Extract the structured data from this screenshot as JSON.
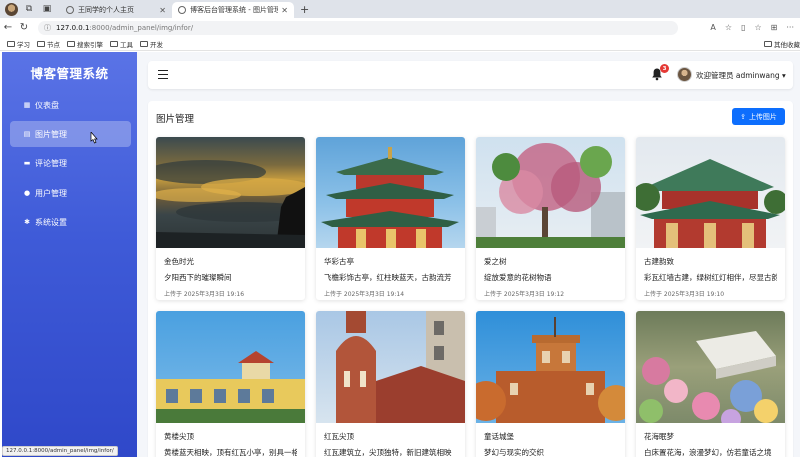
{
  "browser": {
    "tabs": [
      {
        "label": "王同学的个人主页",
        "active": false
      },
      {
        "label": "博客后台管理系统 - 图片管理",
        "active": true
      }
    ],
    "url": {
      "host": "127.0.0.1",
      "path": ":8000/admin_panel/img/infor/"
    },
    "bookmarks": [
      "学习",
      "节点",
      "搜索引擎",
      "工具",
      "开发"
    ],
    "bookmarks_right": "其他收藏",
    "status_url": "127.0.0.1:8000/admin_panel/img/infor/"
  },
  "sidebar": {
    "brand": "博客管理系统",
    "items": [
      {
        "label": "仪表盘",
        "icon": "grid-icon",
        "active": false
      },
      {
        "label": "图片管理",
        "icon": "file-icon",
        "active": true
      },
      {
        "label": "评论管理",
        "icon": "comment-icon",
        "active": false
      },
      {
        "label": "用户管理",
        "icon": "user-icon",
        "active": false
      },
      {
        "label": "系统设置",
        "icon": "gear-icon",
        "active": false
      }
    ]
  },
  "topnav": {
    "badge_count": "3",
    "user_label": "欢迎管理员 adminwang ▾"
  },
  "panel": {
    "title": "图片管理",
    "upload_label": "上传图片",
    "cards": [
      {
        "title": "金色时光",
        "desc": "夕阳西下的璀璨瞬间",
        "date": "上传于 2025年3月3日 19:16"
      },
      {
        "title": "华彩古亭",
        "desc": "飞檐彩饰古亭，红柱映蓝天，古韵流芳",
        "date": "上传于 2025年3月3日 19:14"
      },
      {
        "title": "爱之树",
        "desc": "绽放爱意的花树物语",
        "date": "上传于 2025年3月3日 19:12"
      },
      {
        "title": "古建韵致",
        "desc": "彩瓦红墙古建，绿树红灯相伴，尽显古韵风华",
        "date": "上传于 2025年3月3日 19:10"
      },
      {
        "title": "黄楼尖顶",
        "desc": "黄楼蓝天相映，顶有红瓦小亭，别具一格",
        "date": ""
      },
      {
        "title": "红瓦尖顶",
        "desc": "红瓦建筑立，尖顶独特，新旧建筑相映",
        "date": ""
      },
      {
        "title": "童话城堡",
        "desc": "梦幻与现实的交织",
        "date": ""
      },
      {
        "title": "花海眠梦",
        "desc": "白床置花海，浪漫梦幻，仿若童话之境",
        "date": ""
      }
    ]
  }
}
